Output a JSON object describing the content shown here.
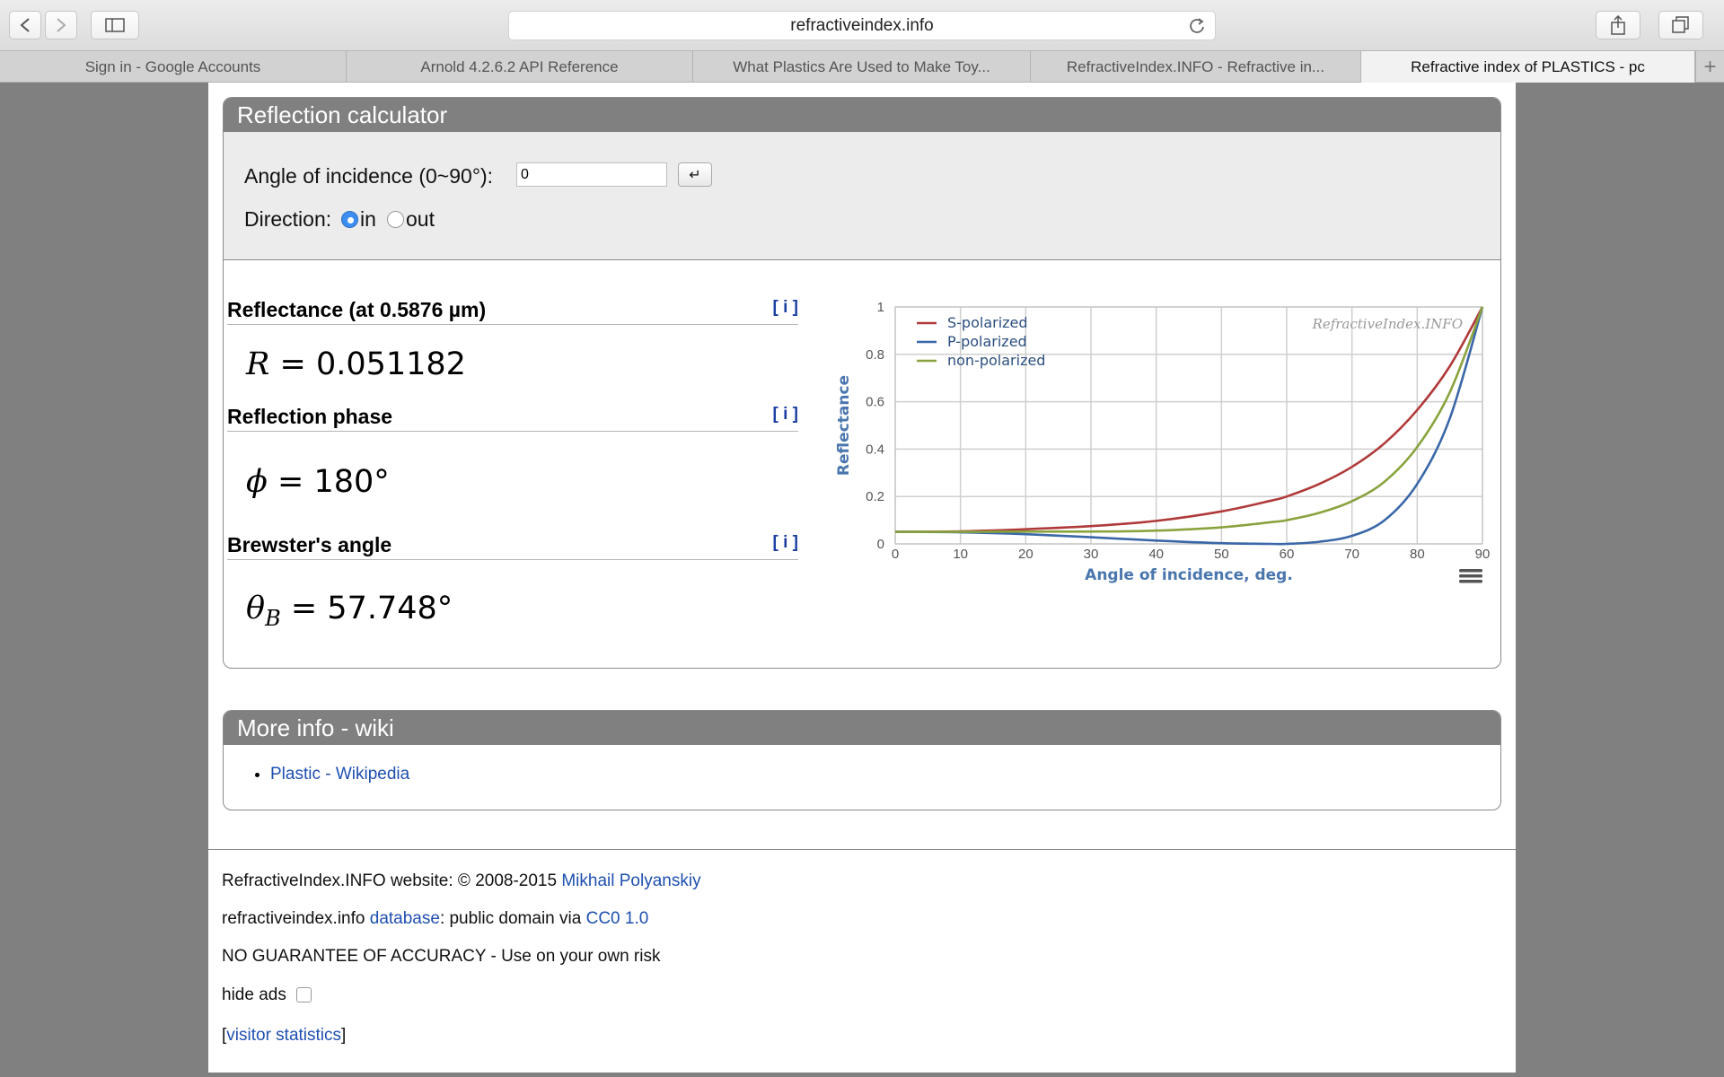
{
  "browser": {
    "url": "refractiveindex.info",
    "tabs": [
      {
        "label": "Sign in - Google Accounts"
      },
      {
        "label": "Arnold 4.2.6.2 API Reference"
      },
      {
        "label": "What Plastics Are Used to Make Toy..."
      },
      {
        "label": "RefractiveIndex.INFO - Refractive in..."
      },
      {
        "label": "Refractive index of PLASTICS - pc"
      }
    ],
    "new_tab": "+"
  },
  "calculator": {
    "title": "Reflection calculator",
    "angle_label": "Angle of incidence (0~90°):",
    "angle_value": "0",
    "enter_symbol": "↵",
    "direction_label": "Direction:",
    "direction_options": [
      "in",
      "out"
    ],
    "direction_selected": "in"
  },
  "results": {
    "reflectance_title": "Reflectance (at 0.5876 µm)",
    "reflectance_value": "0.051182",
    "phase_title": "Reflection phase",
    "phase_value": "180°",
    "brewster_title": "Brewster's angle",
    "brewster_value": "57.748°",
    "info_link": "[ i ]"
  },
  "chart_data": {
    "type": "line",
    "xlabel": "Angle of incidence, deg.",
    "ylabel": "Reflectance",
    "watermark": "RefractiveIndex.INFO",
    "xlim": [
      0,
      90
    ],
    "ylim": [
      0,
      1
    ],
    "x_ticks": [
      0,
      10,
      20,
      30,
      40,
      50,
      60,
      70,
      80,
      90
    ],
    "y_ticks": [
      0,
      0.2,
      0.4,
      0.6,
      0.8,
      1
    ],
    "y_tick_labels": [
      "0",
      "0.2",
      "0.4",
      "0.6",
      "0.8",
      "1"
    ],
    "grid": true,
    "legend_position": "top-left",
    "x": [
      0,
      10,
      20,
      30,
      40,
      50,
      57.7,
      60,
      65,
      70,
      75,
      80,
      85,
      90
    ],
    "series": [
      {
        "name": "S-polarized",
        "color": "#b03a3a",
        "values": [
          0.051,
          0.053,
          0.062,
          0.075,
          0.097,
          0.137,
          0.183,
          0.2,
          0.253,
          0.325,
          0.425,
          0.565,
          0.75,
          1.0
        ]
      },
      {
        "name": "P-polarized",
        "color": "#3a67a8",
        "values": [
          0.051,
          0.049,
          0.041,
          0.028,
          0.014,
          0.003,
          0.0,
          0.0,
          0.009,
          0.034,
          0.1,
          0.253,
          0.53,
          1.0
        ]
      },
      {
        "name": "non-polarized",
        "color": "#89a33e",
        "values": [
          0.051,
          0.051,
          0.052,
          0.052,
          0.056,
          0.07,
          0.092,
          0.1,
          0.131,
          0.18,
          0.263,
          0.409,
          0.64,
          1.0
        ]
      }
    ]
  },
  "more_info": {
    "title": "More info - wiki",
    "links": [
      "Plastic - Wikipedia"
    ]
  },
  "footer": {
    "line1_text": "RefractiveIndex.INFO website: © 2008-2015",
    "line1_link": "Mikhail Polyanskiy",
    "line2_text_a": "refractiveindex.info",
    "line2_link_a": "database",
    "line2_text_b": ": public domain via",
    "line2_link_b": "CC0 1.0",
    "line3_text": "NO GUARANTEE OF ACCURACY - Use on your own risk",
    "hide_ads_label": "hide ads",
    "visitor_link": "visitor statistics"
  }
}
